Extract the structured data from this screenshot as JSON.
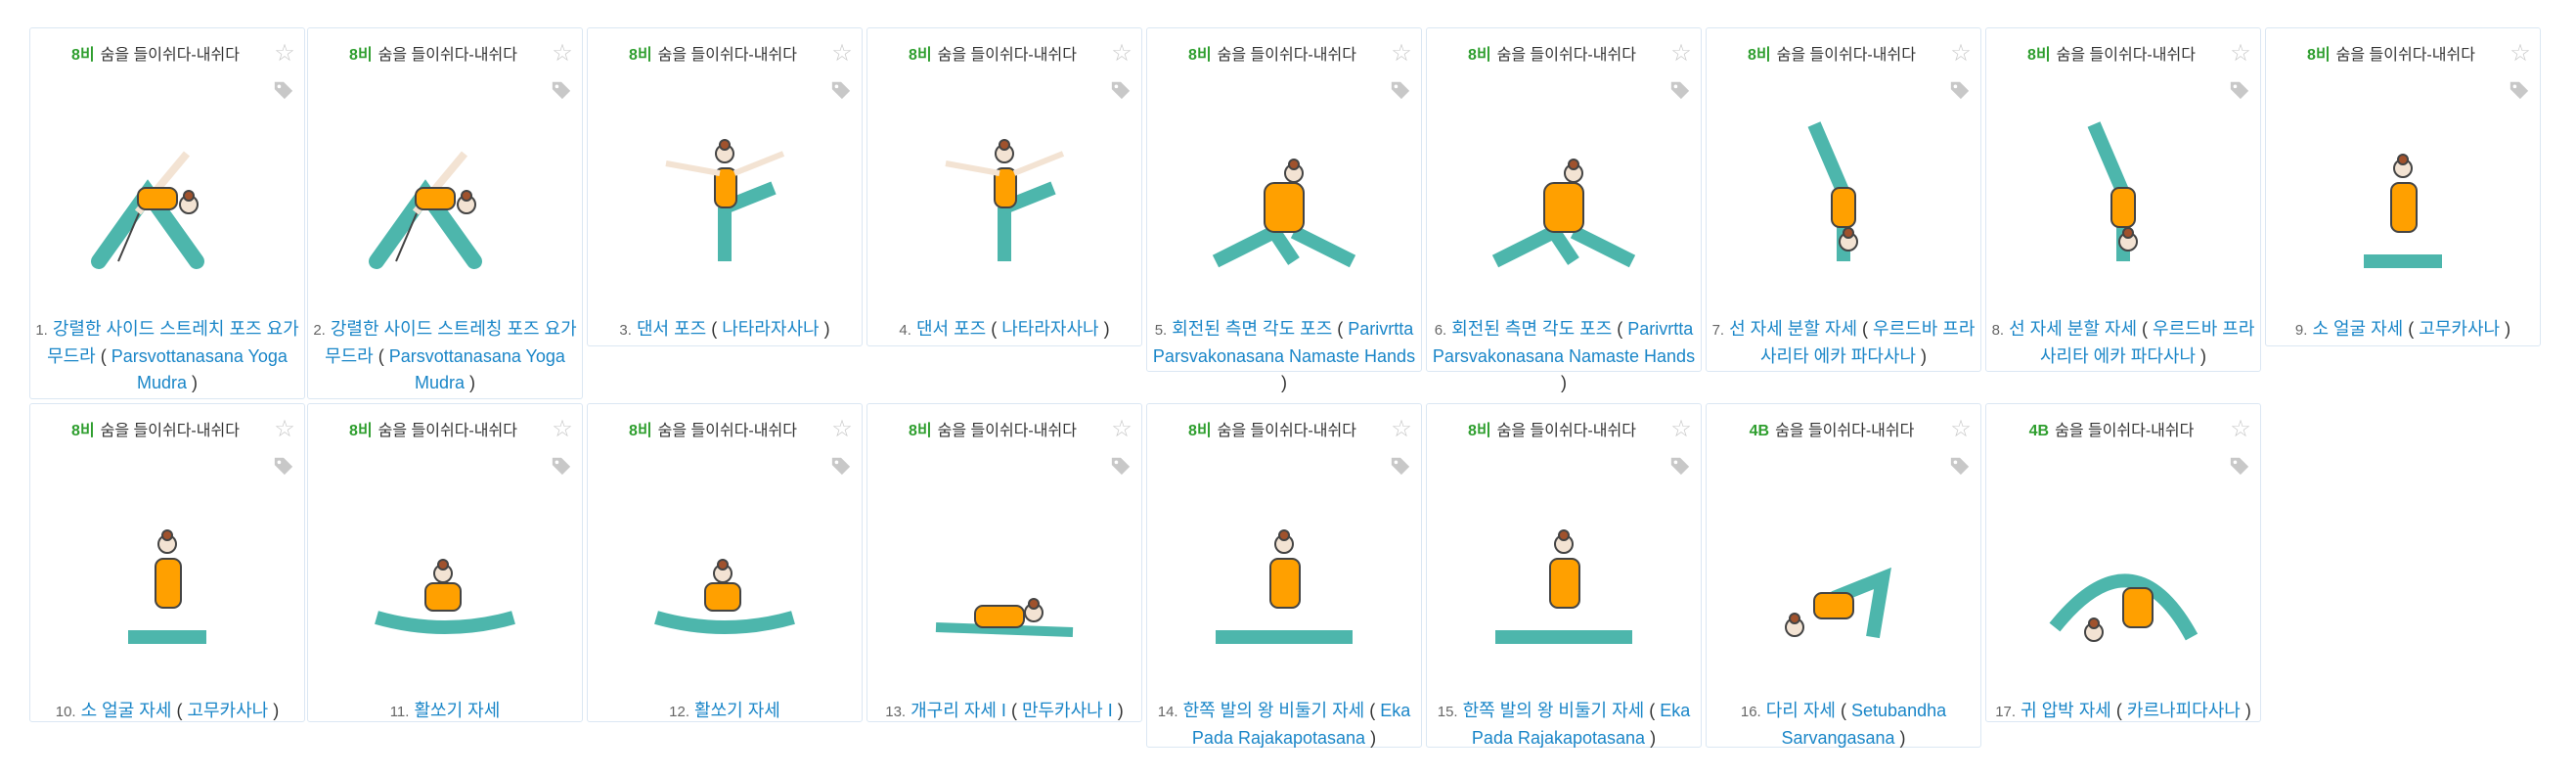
{
  "repeat_label_default": "8비",
  "breath_label": "숨을 들이쉬다-내쉬다",
  "icons": {
    "star": "star-icon",
    "tag": "tag-icon"
  },
  "colors": {
    "accent_green": "#2e9e2e",
    "link_blue": "#1a86c8",
    "teal": "#4db6ac",
    "orange": "#ffa000"
  },
  "cards": [
    {
      "rep": "8비",
      "num": "1.",
      "name": "강렬한 사이드 스트레치 포즈 요가 무드라",
      "alt": "Parsvottanasana Yoga Mudra"
    },
    {
      "rep": "8비",
      "num": "2.",
      "name": "강렬한 사이드 스트레칭 포즈 요가 무드라",
      "alt": "Parsvottanasana Yoga Mudra"
    },
    {
      "rep": "8비",
      "num": "3.",
      "name": "댄서 포즈",
      "alt": "나타라자사나"
    },
    {
      "rep": "8비",
      "num": "4.",
      "name": "댄서 포즈",
      "alt": "나타라자사나"
    },
    {
      "rep": "8비",
      "num": "5.",
      "name": "회전된 측면 각도 포즈",
      "alt": "Parivrtta Parsvakonasana Namaste Hands"
    },
    {
      "rep": "8비",
      "num": "6.",
      "name": "회전된 측면 각도 포즈",
      "alt": "Parivrtta Parsvakonasana Namaste Hands"
    },
    {
      "rep": "8비",
      "num": "7.",
      "name": "선 자세 분할 자세",
      "alt": "우르드바 프라사리타 에카 파다사나"
    },
    {
      "rep": "8비",
      "num": "8.",
      "name": "선 자세 분할 자세",
      "alt": "우르드바 프라사리타 에카 파다사나"
    },
    {
      "rep": "8비",
      "num": "9.",
      "name": "소 얼굴 자세",
      "alt": "고무카사나"
    },
    {
      "rep": "8비",
      "num": "10.",
      "name": "소 얼굴 자세",
      "alt": "고무카사나"
    },
    {
      "rep": "8비",
      "num": "11.",
      "name": "활쏘기 자세",
      "alt": ""
    },
    {
      "rep": "8비",
      "num": "12.",
      "name": "활쏘기 자세",
      "alt": ""
    },
    {
      "rep": "8비",
      "num": "13.",
      "name": "개구리 자세 I",
      "alt": "만두카사나 I"
    },
    {
      "rep": "8비",
      "num": "14.",
      "name": "한쪽 발의 왕 비둘기 자세",
      "alt": "Eka Pada Rajakapotasana"
    },
    {
      "rep": "8비",
      "num": "15.",
      "name": "한쪽 발의 왕 비둘기 자세",
      "alt": "Eka Pada Rajakapotasana"
    },
    {
      "rep": "4B",
      "num": "16.",
      "name": "다리 자세",
      "alt": "Setubandha Sarvangasana"
    },
    {
      "rep": "4B",
      "num": "17.",
      "name": "귀 압박 자세",
      "alt": "카르나피다사나"
    }
  ]
}
